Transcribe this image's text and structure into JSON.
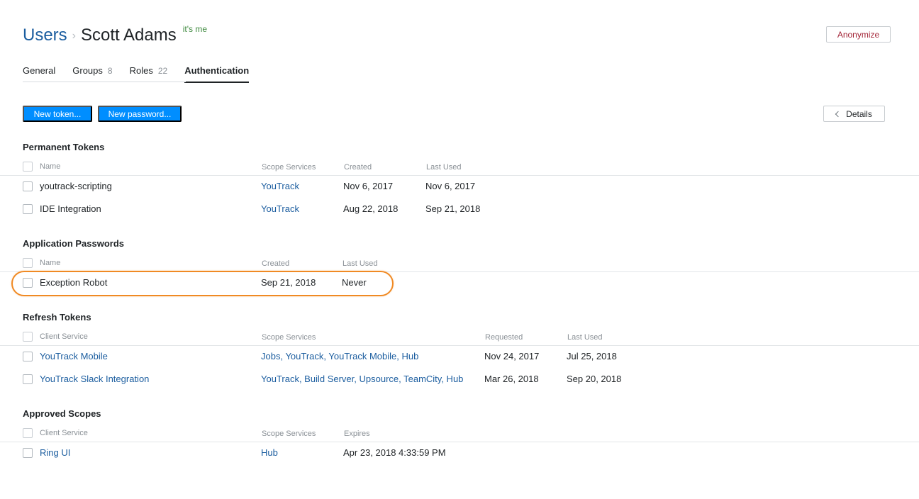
{
  "breadcrumb": {
    "parent": "Users",
    "separator": "›",
    "current": "Scott Adams",
    "badge": "it's me"
  },
  "header_actions": {
    "anonymize_label": "Anonymize"
  },
  "tabs": [
    {
      "label": "General",
      "count": ""
    },
    {
      "label": "Groups",
      "count": "8"
    },
    {
      "label": "Roles",
      "count": "22"
    },
    {
      "label": "Authentication",
      "count": ""
    }
  ],
  "toolbar": {
    "new_token_label": "New token...",
    "new_password_label": "New password...",
    "details_label": "Details"
  },
  "permanent_tokens": {
    "title": "Permanent Tokens",
    "columns": [
      "Name",
      "Scope Services",
      "Created",
      "Last Used"
    ],
    "rows": [
      {
        "name": "youtrack-scripting",
        "scope": "YouTrack",
        "created": "Nov 6, 2017",
        "last_used": "Nov 6, 2017"
      },
      {
        "name": "IDE Integration",
        "scope": "YouTrack",
        "created": "Aug 22, 2018",
        "last_used": "Sep 21, 2018"
      }
    ]
  },
  "application_passwords": {
    "title": "Application Passwords",
    "columns": [
      "Name",
      "Created",
      "Last Used"
    ],
    "rows": [
      {
        "name": "Exception Robot",
        "created": "Sep 21, 2018",
        "last_used": "Never"
      }
    ]
  },
  "refresh_tokens": {
    "title": "Refresh Tokens",
    "columns": [
      "Client Service",
      "Scope Services",
      "Requested",
      "Last Used"
    ],
    "rows": [
      {
        "client": "YouTrack Mobile",
        "scope": "Jobs, YouTrack, YouTrack Mobile, Hub",
        "requested": "Nov 24, 2017",
        "last_used": "Jul 25, 2018"
      },
      {
        "client": "YouTrack Slack Integration",
        "scope": "YouTrack, Build Server, Upsource, TeamCity, Hub",
        "requested": "Mar 26, 2018",
        "last_used": "Sep 20, 2018"
      }
    ]
  },
  "approved_scopes": {
    "title": "Approved Scopes",
    "columns": [
      "Client Service",
      "Scope Services",
      "Expires"
    ],
    "rows": [
      {
        "client": "Ring UI",
        "scope": "Hub",
        "expires": "Apr 23, 2018 4:33:59 PM"
      }
    ]
  },
  "colors": {
    "link": "#1b5d9f",
    "primary": "#008eff",
    "danger": "#a4283a",
    "highlight": "#f08a24",
    "badge": "#3f8a3f"
  }
}
